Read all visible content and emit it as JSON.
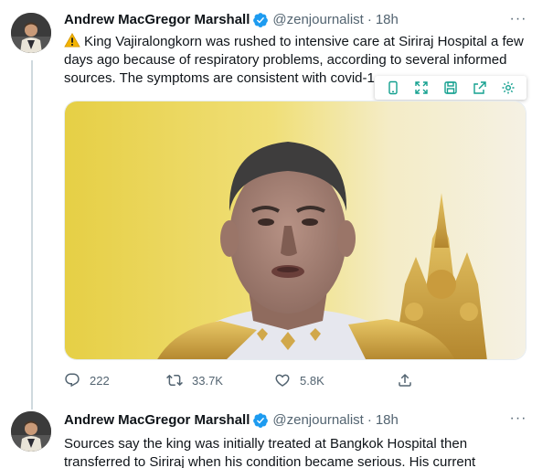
{
  "colors": {
    "brand_blue": "#1d9bf0",
    "text_primary": "#0f1419",
    "text_secondary": "#536471",
    "toolbar_icon": "#13a08f"
  },
  "tweets": [
    {
      "author_name": "Andrew MacGregor Marshall",
      "handle": "@zenjournalist",
      "separator": "·",
      "time": "18h",
      "more_label": "···",
      "text": "King Vajiralongkorn was rushed to intensive care at Siriraj Hospital a few days ago because of respiratory problems, according to several informed sources. The symptoms are consistent with covid-1",
      "leading_icon": "warning-icon",
      "reply_count": "222",
      "retweet_count": "33.7K",
      "like_count": "5.8K"
    },
    {
      "author_name": "Andrew MacGregor Marshall",
      "handle": "@zenjournalist",
      "separator": "·",
      "time": "18h",
      "more_label": "···",
      "text": "Sources say the king was initially treated at Bangkok Hospital then\ntransferred to Siriraj when his condition became serious. His current"
    }
  ],
  "overlay_toolbar": {
    "icons": [
      "phone-icon",
      "expand-icon",
      "save-icon",
      "share-out-icon",
      "settings-icon"
    ]
  }
}
